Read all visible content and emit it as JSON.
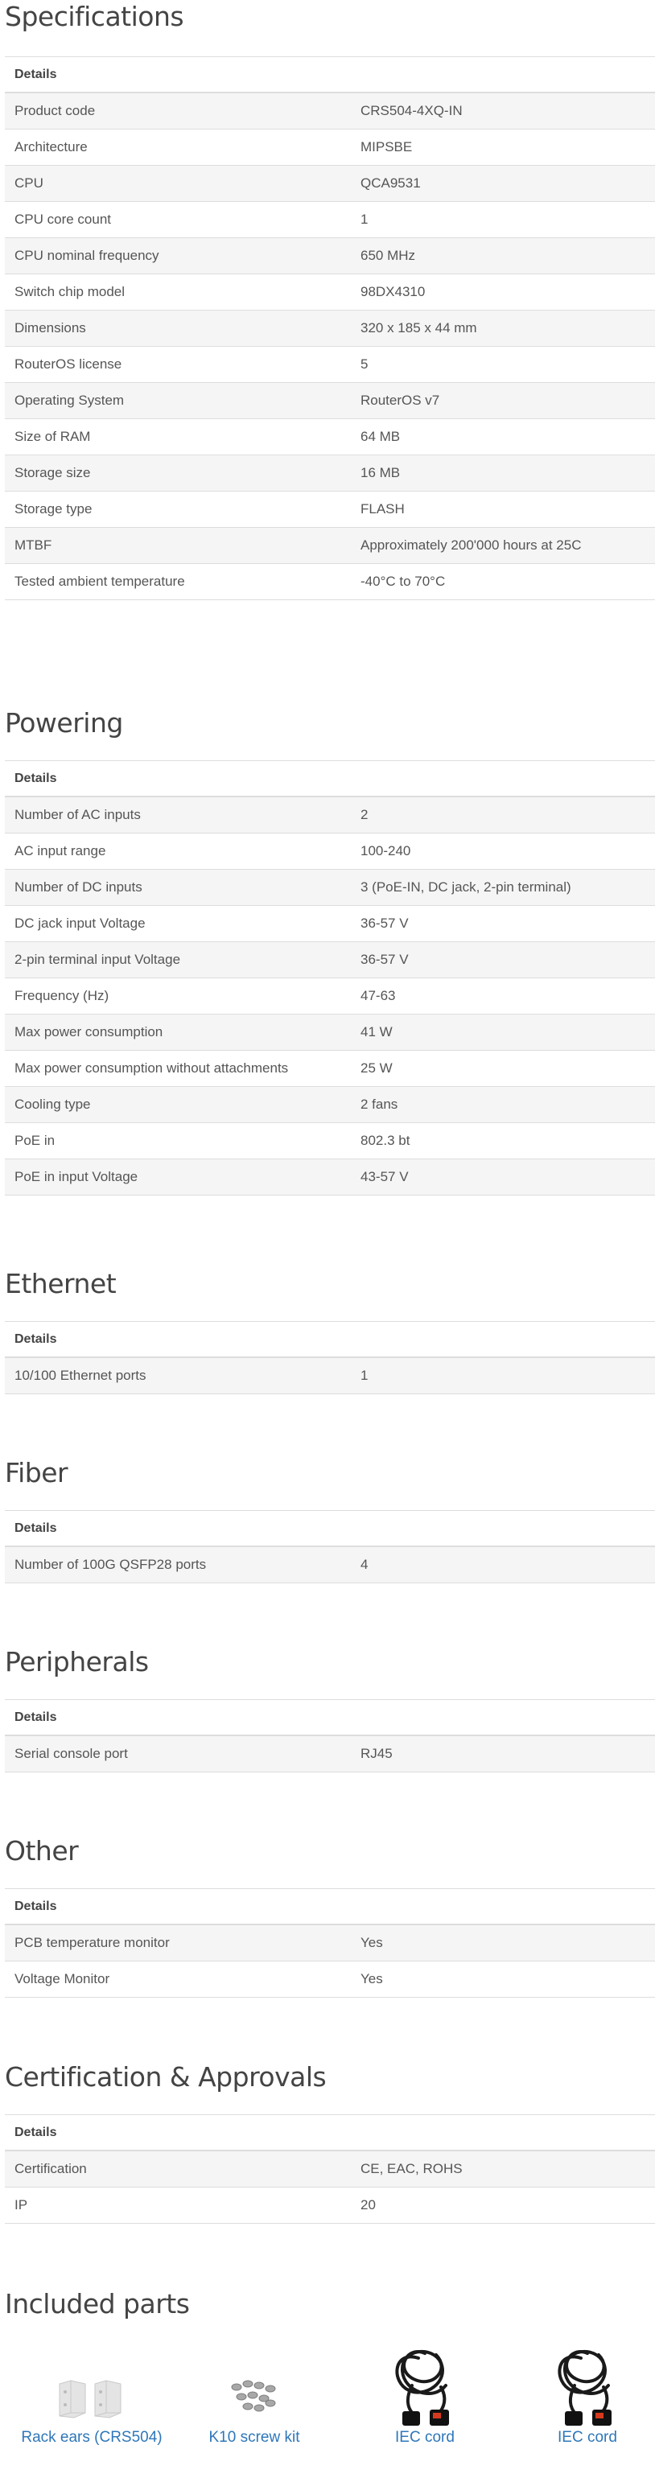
{
  "sections": {
    "specifications": {
      "title": "Specifications",
      "header": "Details",
      "rows": [
        {
          "label": "Product code",
          "value": "CRS504-4XQ-IN"
        },
        {
          "label": "Architecture",
          "value": "MIPSBE"
        },
        {
          "label": "CPU",
          "value": "QCA9531"
        },
        {
          "label": "CPU core count",
          "value": "1"
        },
        {
          "label": "CPU nominal frequency",
          "value": "650 MHz"
        },
        {
          "label": "Switch chip model",
          "value": "98DX4310"
        },
        {
          "label": "Dimensions",
          "value": "320 x 185 x 44 mm"
        },
        {
          "label": "RouterOS license",
          "value": "5"
        },
        {
          "label": "Operating System",
          "value": "RouterOS v7"
        },
        {
          "label": "Size of RAM",
          "value": "64 MB"
        },
        {
          "label": "Storage size",
          "value": "16 MB"
        },
        {
          "label": "Storage type",
          "value": "FLASH"
        },
        {
          "label": "MTBF",
          "value": "Approximately 200'000 hours at 25C"
        },
        {
          "label": "Tested ambient temperature",
          "value": "-40°C to 70°C"
        }
      ]
    },
    "powering": {
      "title": "Powering",
      "header": "Details",
      "rows": [
        {
          "label": "Number of AC inputs",
          "value": "2"
        },
        {
          "label": "AC input range",
          "value": "100-240"
        },
        {
          "label": "Number of DC inputs",
          "value": "3 (PoE-IN, DC jack, 2-pin terminal)"
        },
        {
          "label": "DC jack input Voltage",
          "value": "36-57 V"
        },
        {
          "label": "2-pin terminal input Voltage",
          "value": "36-57 V"
        },
        {
          "label": "Frequency (Hz)",
          "value": "47-63"
        },
        {
          "label": "Max power consumption",
          "value": "41 W"
        },
        {
          "label": "Max power consumption without attachments",
          "value": "25 W"
        },
        {
          "label": "Cooling type",
          "value": "2 fans"
        },
        {
          "label": "PoE in",
          "value": "802.3 bt"
        },
        {
          "label": "PoE in input Voltage",
          "value": "43-57 V"
        }
      ]
    },
    "ethernet": {
      "title": "Ethernet",
      "header": "Details",
      "rows": [
        {
          "label": "10/100 Ethernet ports",
          "value": "1"
        }
      ]
    },
    "fiber": {
      "title": "Fiber",
      "header": "Details",
      "rows": [
        {
          "label": "Number of 100G QSFP28 ports",
          "value": "4"
        }
      ]
    },
    "peripherals": {
      "title": "Peripherals",
      "header": "Details",
      "rows": [
        {
          "label": "Serial console port",
          "value": "RJ45"
        }
      ]
    },
    "other": {
      "title": "Other",
      "header": "Details",
      "rows": [
        {
          "label": "PCB temperature monitor",
          "value": "Yes"
        },
        {
          "label": "Voltage Monitor",
          "value": "Yes"
        }
      ]
    },
    "certification": {
      "title": "Certification & Approvals",
      "header": "Details",
      "rows": [
        {
          "label": "Certification",
          "value": "CE, EAC, ROHS"
        },
        {
          "label": "IP",
          "value": "20"
        }
      ]
    }
  },
  "included_parts": {
    "title": "Included parts",
    "items": [
      {
        "label": "Rack ears (CRS504)",
        "icon": "rack-ears-image"
      },
      {
        "label": "K10 screw kit",
        "icon": "screw-kit-image"
      },
      {
        "label": "IEC cord",
        "icon": "iec-cord-image"
      },
      {
        "label": "IEC cord",
        "icon": "iec-cord-image"
      }
    ]
  },
  "colors": {
    "link": "#2e77ba",
    "stripe": "#f5f5f5",
    "border": "#dddddd",
    "heading": "#444444"
  }
}
